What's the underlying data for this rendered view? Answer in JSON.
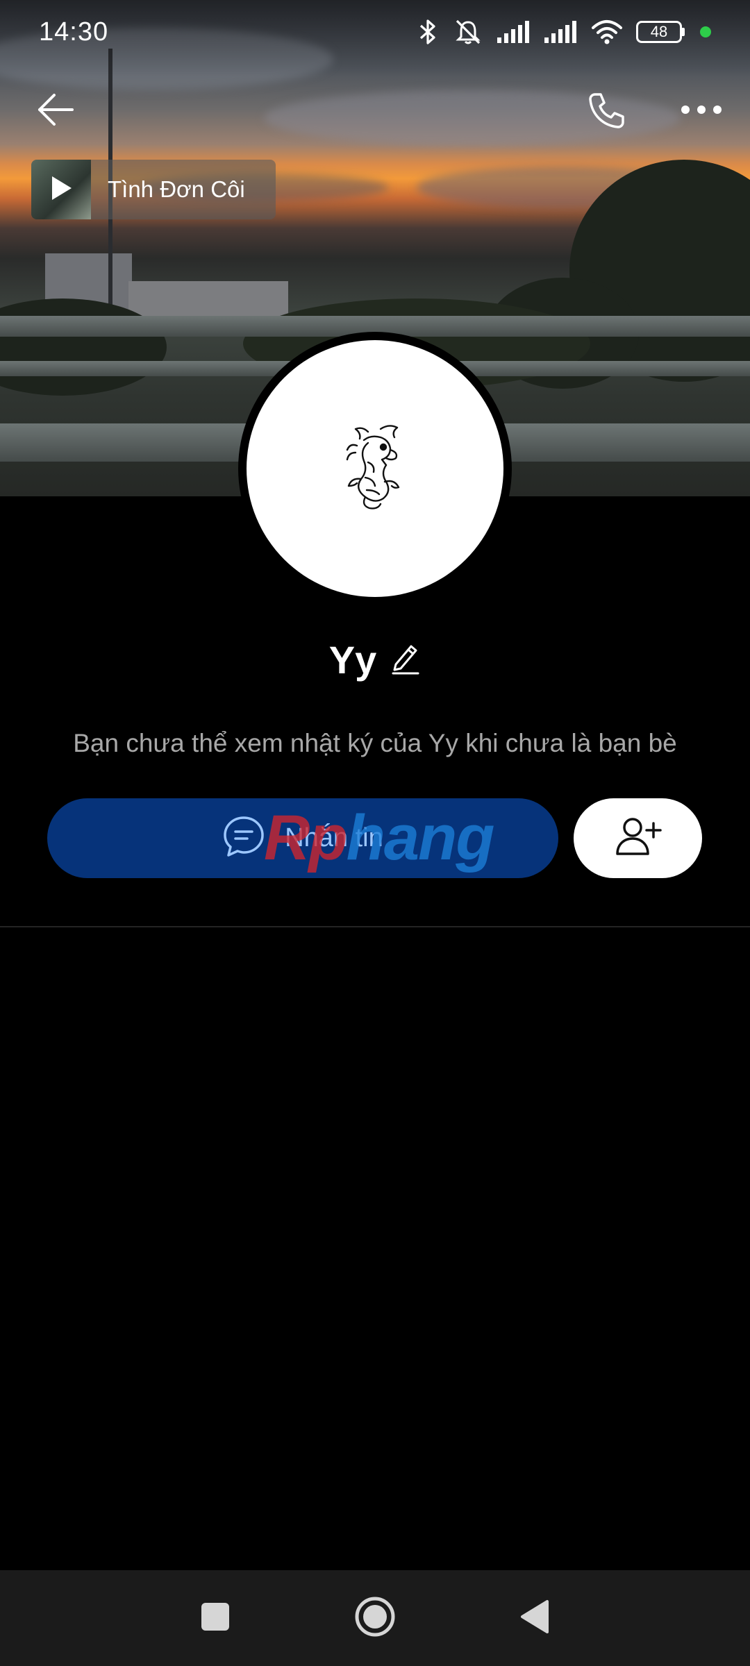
{
  "status_bar": {
    "time": "14:30",
    "battery": "48",
    "icons": [
      "bluetooth-icon",
      "bell-off-icon",
      "signal-icon",
      "signal-icon",
      "wifi-icon",
      "battery-icon"
    ]
  },
  "header": {
    "back_icon": "arrow-left-icon",
    "call_icon": "phone-icon",
    "more_icon": "more-horizontal-icon"
  },
  "music": {
    "title": "Tình Đơn Côi",
    "icon": "play-icon"
  },
  "profile": {
    "name": "Yy",
    "edit_icon": "pencil-icon",
    "notice": "Bạn chưa thể xem nhật ký của Yy khi chưa là bạn bè"
  },
  "actions": {
    "message_label": "Nhắn tin",
    "message_icon": "chat-bubble-icon",
    "add_friend_icon": "user-plus-icon"
  },
  "watermark": {
    "part1": "Rp",
    "part2": "hang"
  },
  "colors": {
    "message_button_bg": "#06337a",
    "message_label": "#9cc7ff",
    "online_dot": "#2ecc4a"
  }
}
